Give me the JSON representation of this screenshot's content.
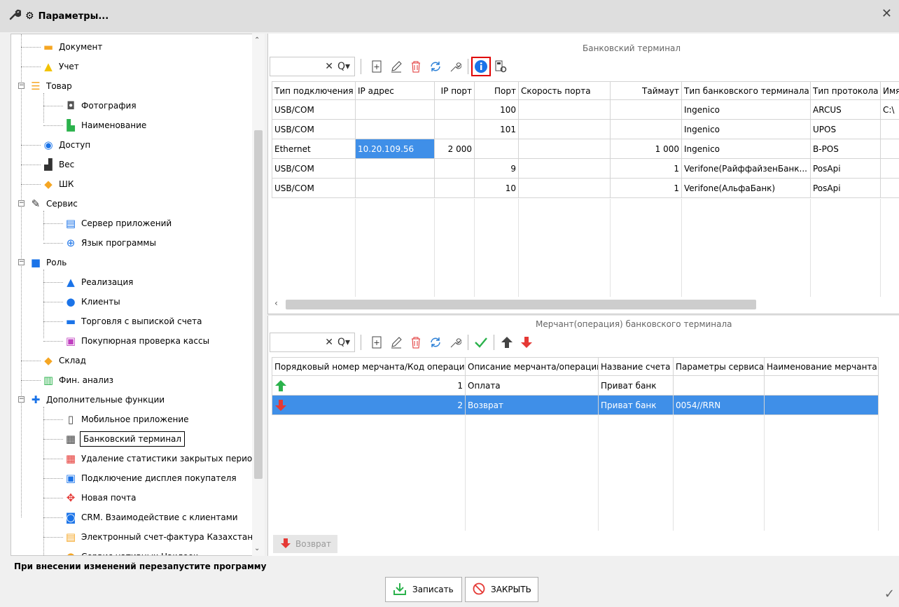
{
  "window": {
    "title": "Параметры...",
    "close_glyph": "✕"
  },
  "sidebar": {
    "items": [
      {
        "label": "Документ",
        "icon": "document-icon"
      },
      {
        "label": "Учет",
        "icon": "warning-icon"
      },
      {
        "label": "Товар",
        "icon": "list-icon"
      },
      {
        "label": "Фотография",
        "icon": "camera-icon"
      },
      {
        "label": "Наименование",
        "icon": "name-tag-icon"
      },
      {
        "label": "Доступ",
        "icon": "eye-icon"
      },
      {
        "label": "Вес",
        "icon": "weight-icon"
      },
      {
        "label": "ШК",
        "icon": "tag-icon"
      },
      {
        "label": "Сервис",
        "icon": "wrench-icon"
      },
      {
        "label": "Сервер приложений",
        "icon": "server-icon"
      },
      {
        "label": "Язык программы",
        "icon": "globe-icon"
      },
      {
        "label": "Роль",
        "icon": "user-role-icon"
      },
      {
        "label": "Реализация",
        "icon": "upload-icon"
      },
      {
        "label": "Клиенты",
        "icon": "person-icon"
      },
      {
        "label": "Торговля с выпиской счета",
        "icon": "invoice-icon"
      },
      {
        "label": "Покупюрная проверка кассы",
        "icon": "cash-check-icon"
      },
      {
        "label": "Склад",
        "icon": "layers-icon"
      },
      {
        "label": "Фин. анализ",
        "icon": "finance-chart-icon"
      },
      {
        "label": "Дополнительные функции",
        "icon": "puzzle-icon"
      },
      {
        "label": "Мобильное приложение",
        "icon": "mobile-icon"
      },
      {
        "label": "Банковский терминал",
        "icon": "pos-terminal-icon"
      },
      {
        "label": "Удаление статистики закрытых периодов",
        "icon": "delete-stats-icon"
      },
      {
        "label": "Подключение дисплея покупателя",
        "icon": "display-icon"
      },
      {
        "label": "Новая почта",
        "icon": "new-post-icon"
      },
      {
        "label": "CRM. Взаимодействие с клиентами",
        "icon": "crm-icon"
      },
      {
        "label": "Электронный счет-фактура Казахстана",
        "icon": "e-invoice-icon"
      },
      {
        "label": "Сервис нативных Наклеек",
        "icon": "sticker-icon"
      }
    ]
  },
  "terminals": {
    "title": "Банковский терминал",
    "columns": [
      "Тип подключения",
      "IP адрес",
      "IP порт",
      "Порт",
      "Скорость порта",
      "Таймаут",
      "Тип банковского терминала",
      "Тип протокола",
      "Имя"
    ],
    "rows": [
      [
        "USB/COM",
        "",
        "",
        "100",
        "",
        "",
        "Ingenico",
        "ARCUS",
        "C:\\"
      ],
      [
        "USB/COM",
        "",
        "",
        "101",
        "",
        "",
        "Ingenico",
        "UPOS",
        ""
      ],
      [
        "Ethernet",
        "10.20.109.56",
        "2 000",
        "",
        "",
        "1 000",
        "Ingenico",
        "B-POS",
        ""
      ],
      [
        "USB/COM",
        "",
        "",
        "9",
        "",
        "1",
        "Verifone(РайффайзенБанк...",
        "PosApi",
        ""
      ],
      [
        "USB/COM",
        "",
        "",
        "10",
        "",
        "1",
        "Verifone(АльфаБанк)",
        "PosApi",
        ""
      ]
    ]
  },
  "merchants": {
    "title": "Мерчант(операция) банковского терминала",
    "columns": [
      "Порядковый номер мерчанта/Код операции",
      "Описание мерчанта/операции",
      "Название счета",
      "Параметры сервиса",
      "Наименование мерчанта"
    ],
    "rows": [
      [
        "1",
        "Оплата",
        "Приват банк",
        "",
        ""
      ],
      [
        "2",
        "Возврат",
        "Приват банк",
        "0054//RRN",
        ""
      ]
    ]
  },
  "return_button": "Возврат",
  "footer": {
    "notice": "При внесении изменений перезапустите программу",
    "save": "Записать",
    "close": "ЗАКРЫТЬ"
  },
  "colors": {
    "accent": "#3f8fe8",
    "highlight": "#e00000",
    "info": "#1a73e8"
  }
}
